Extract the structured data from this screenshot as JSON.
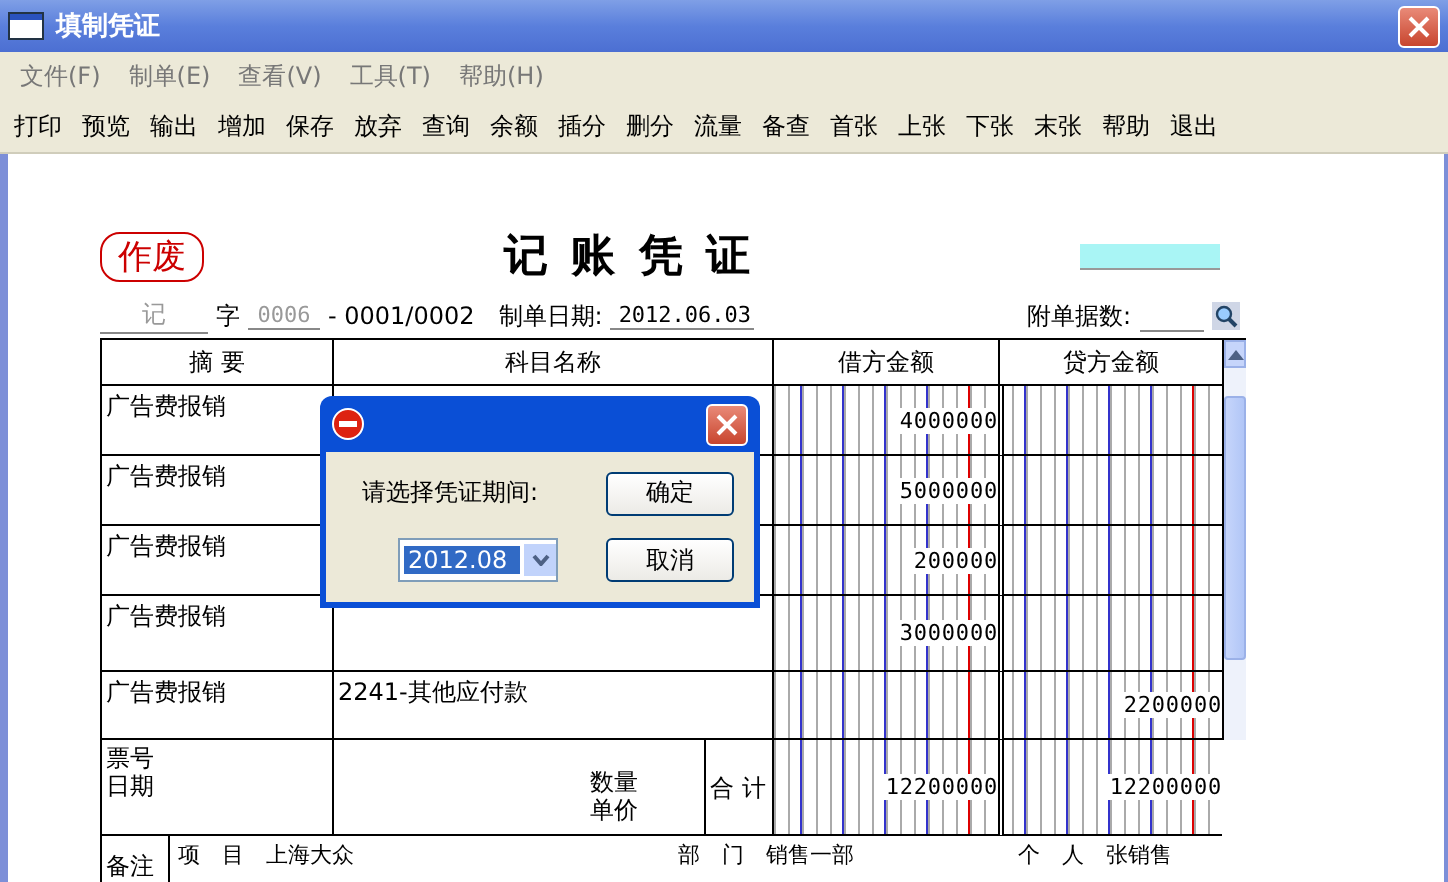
{
  "window": {
    "title": "填制凭证"
  },
  "menu": [
    "文件(F)",
    "制单(E)",
    "查看(V)",
    "工具(T)",
    "帮助(H)"
  ],
  "toolbar": [
    "打印",
    "预览",
    "输出",
    "增加",
    "保存",
    "放弃",
    "查询",
    "余额",
    "插分",
    "删分",
    "流量",
    "备查",
    "首张",
    "上张",
    "下张",
    "末张",
    "帮助",
    "退出"
  ],
  "voucher": {
    "stamp": "作废",
    "title": "记 账 凭 证",
    "type": "记",
    "type_suffix": "字",
    "number": "0006",
    "page": "- 0001/0002",
    "date_label": "制单日期:",
    "date": "2012.06.03",
    "attachments_label": "附单据数:",
    "columns": [
      "摘 要",
      "科目名称",
      "借方金额",
      "贷方金额"
    ],
    "rows": [
      {
        "summary": "广告费报销",
        "account": "",
        "debit": "4000000",
        "credit": ""
      },
      {
        "summary": "广告费报销",
        "account": "",
        "debit": "5000000",
        "credit": ""
      },
      {
        "summary": "广告费报销",
        "account": "",
        "debit": "200000",
        "credit": ""
      },
      {
        "summary": "广告费报销",
        "account": "",
        "debit": "3000000",
        "credit": ""
      },
      {
        "summary": "广告费报销",
        "account": "2241-其他应付款",
        "debit": "",
        "credit": "2200000"
      }
    ],
    "footer": {
      "ticket_label": "票号",
      "date_label": "日期",
      "quantity_label": "数量",
      "price_label": "单价",
      "total_label": "合 计",
      "debit_total": "12200000",
      "credit_total": "12200000"
    },
    "remarks": {
      "label": "备注",
      "items": [
        {
          "label": "项　目",
          "value": "上海大众"
        },
        {
          "label": "部　门",
          "value": "销售一部"
        },
        {
          "label": "个　人",
          "value": "张销售"
        }
      ]
    }
  },
  "dialog": {
    "message": "请选择凭证期间:",
    "period": "2012.08",
    "buttons": [
      "确定",
      "取消"
    ]
  }
}
